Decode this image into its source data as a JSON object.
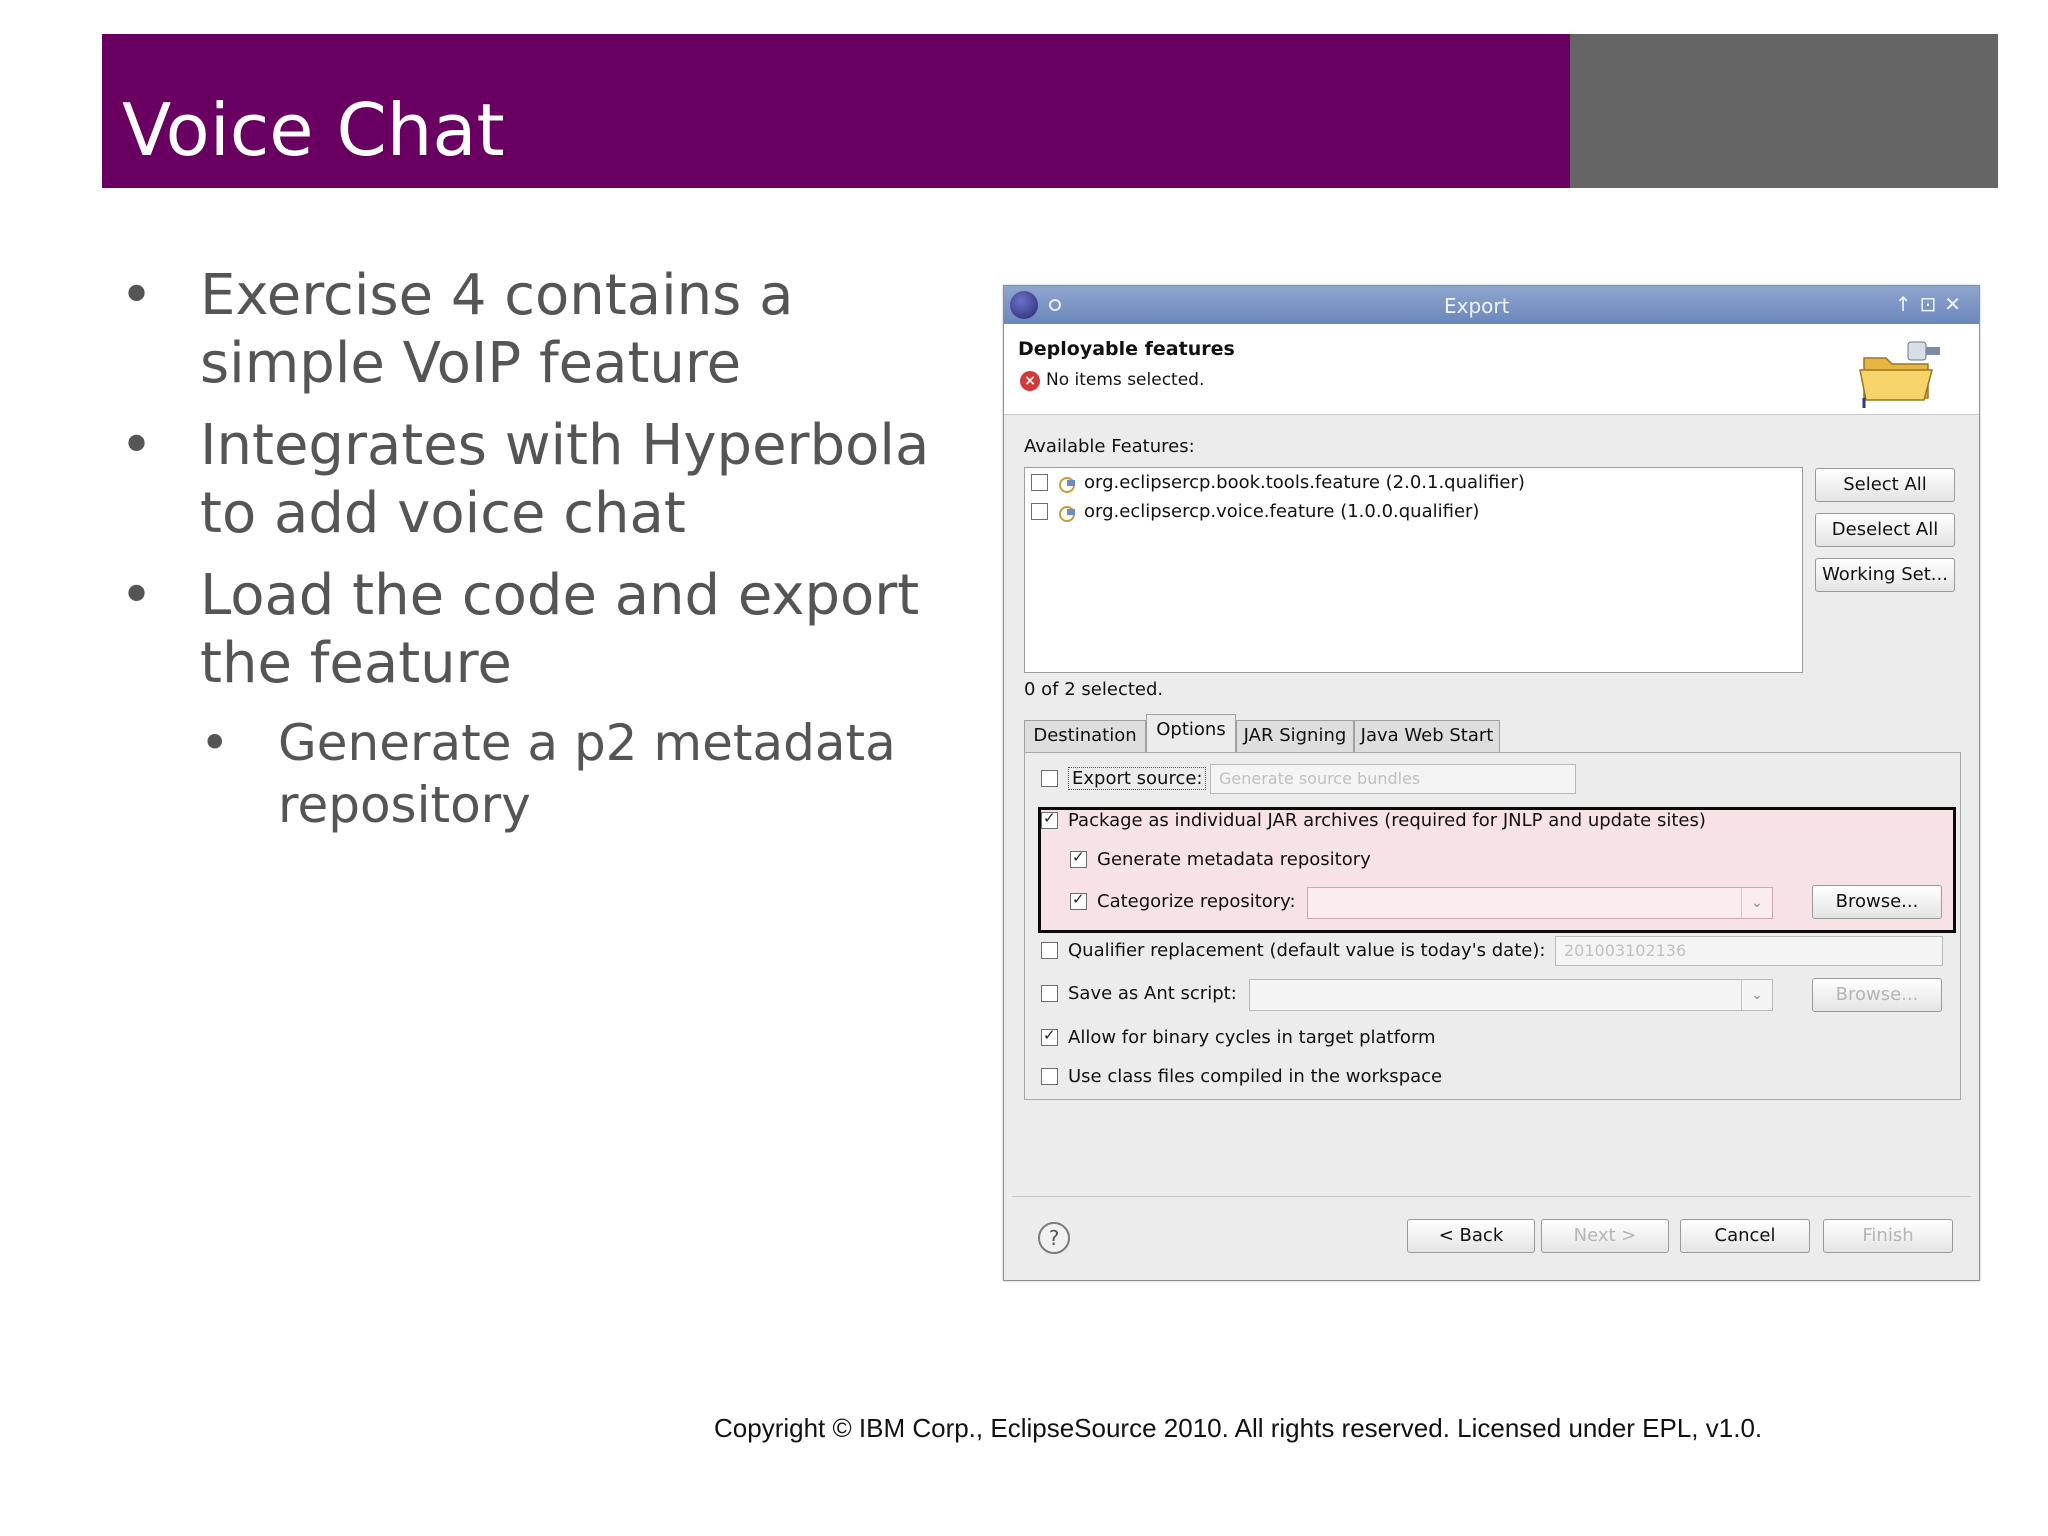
{
  "slide": {
    "title": "Voice Chat",
    "bullets": [
      "Exercise 4 contains a simple VoIP feature",
      "Integrates with Hyperbola to add voice chat",
      "Load the code and export the feature"
    ],
    "sub_bullets": [
      "Generate a p2 metadata repository"
    ],
    "copyright": "Copyright © IBM Corp., EclipseSource 2010. All rights reserved.  Licensed under EPL, v1.0."
  },
  "dialog": {
    "title": "Export",
    "header_title": "Deployable features",
    "header_message": "No items selected.",
    "available_label": "Available Features:",
    "features": [
      {
        "label": "org.eclipsercp.book.tools.feature (2.0.1.qualifier)",
        "checked": false
      },
      {
        "label": "org.eclipsercp.voice.feature (1.0.0.qualifier)",
        "checked": false
      }
    ],
    "select_all": "Select All",
    "deselect_all": "Deselect All",
    "working_set": "Working Set...",
    "selected_count": "0 of 2 selected.",
    "tabs": [
      "Destination",
      "Options",
      "JAR Signing",
      "Java Web Start"
    ],
    "active_tab": "Options",
    "options": {
      "export_source": {
        "label": "Export source:",
        "checked": false,
        "value": "Generate source bundles"
      },
      "package_jar": {
        "label": "Package as individual JAR archives (required for JNLP and update sites)",
        "checked": true
      },
      "generate_metadata": {
        "label": "Generate metadata repository",
        "checked": true
      },
      "categorize": {
        "label": "Categorize repository:",
        "checked": true,
        "value": ""
      },
      "browse": "Browse...",
      "qualifier": {
        "label": "Qualifier replacement (default value is today's date):",
        "checked": false,
        "value": "201003102136"
      },
      "ant_script": {
        "label": "Save as Ant script:",
        "checked": false,
        "value": ""
      },
      "browse_disabled": "Browse...",
      "binary_cycles": {
        "label": "Allow for binary cycles in target platform",
        "checked": true
      },
      "class_files": {
        "label": "Use class files compiled in the workspace",
        "checked": false
      }
    },
    "buttons": {
      "help": "?",
      "back": "< Back",
      "next": "Next >",
      "cancel": "Cancel",
      "finish": "Finish"
    }
  },
  "colors": {
    "title_bar": "#690061",
    "title_side": "#656565",
    "highlight_fill": "#f7e3e5"
  }
}
